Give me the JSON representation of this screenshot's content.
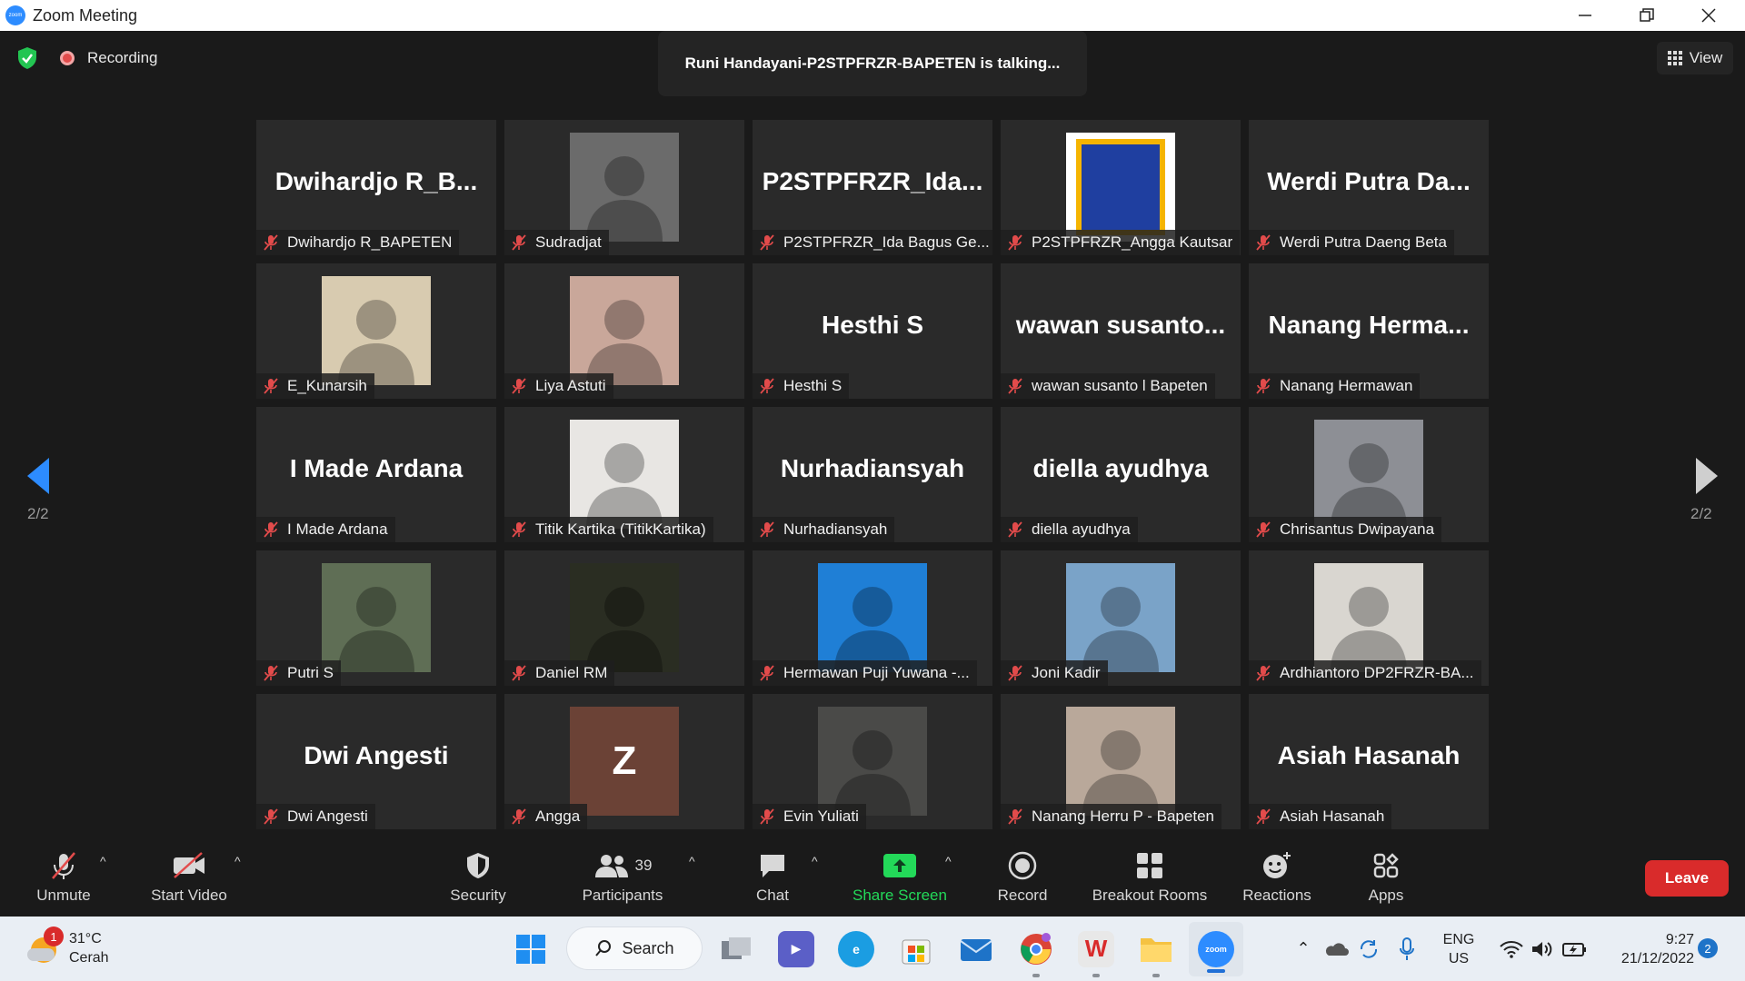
{
  "window": {
    "title": "Zoom Meeting"
  },
  "header": {
    "recording_label": "Recording",
    "talking_banner": "Runi Handayani-P2STPFRZR-BAPETEN is talking...",
    "view_label": "View"
  },
  "pagination": {
    "left_indicator": "2/2",
    "right_indicator": "2/2"
  },
  "tiles": [
    {
      "big_name": "Dwihardjo  R_B...",
      "label": "Dwihardjo R_BAPETEN",
      "has_avatar": false
    },
    {
      "big_name": "",
      "label": "Sudradjat",
      "has_avatar": true,
      "avatar": "photo-traffic-light",
      "bg": "#6b6b6b"
    },
    {
      "big_name": "P2STPFRZR_Ida...",
      "label": "P2STPFRZR_Ida Bagus Ge...",
      "has_avatar": false
    },
    {
      "big_name": "",
      "label": "P2STPFRZR_Angga Kautsar",
      "has_avatar": true,
      "avatar": "logo-ak",
      "bg": "#ffffff"
    },
    {
      "big_name": "Werdi  Putra  Da...",
      "label": "Werdi Putra Daeng Beta",
      "has_avatar": false
    },
    {
      "big_name": "",
      "label": "E_Kunarsih",
      "has_avatar": true,
      "avatar": "photo-film-portrait",
      "bg": "#d8cbb0"
    },
    {
      "big_name": "",
      "label": "Liya Astuti",
      "has_avatar": true,
      "avatar": "photo-hijab-smile",
      "bg": "#c9a79a"
    },
    {
      "big_name": "Hesthi S",
      "label": "Hesthi S",
      "has_avatar": false
    },
    {
      "big_name": "wawan  susanto...",
      "label": "wawan susanto l Bapeten",
      "has_avatar": false
    },
    {
      "big_name": "Nanang  Herma...",
      "label": "Nanang Hermawan",
      "has_avatar": false
    },
    {
      "big_name": "I Made Ardana",
      "label": "I Made Ardana",
      "has_avatar": false
    },
    {
      "big_name": "",
      "label": "Titik Kartika (TitikKartika)",
      "has_avatar": true,
      "avatar": "photo-hijab-mask",
      "bg": "#e8e6e3"
    },
    {
      "big_name": "Nurhadiansyah",
      "label": "Nurhadiansyah",
      "has_avatar": false
    },
    {
      "big_name": "diella ayudhya",
      "label": "diella ayudhya",
      "has_avatar": false
    },
    {
      "big_name": "",
      "label": "Chrisantus Dwipayana",
      "has_avatar": true,
      "avatar": "photo-mountain-couple",
      "bg": "#8d8f95"
    },
    {
      "big_name": "",
      "label": "Putri S",
      "has_avatar": true,
      "avatar": "photo-grass",
      "bg": "#5f6e55"
    },
    {
      "big_name": "",
      "label": "Daniel RM",
      "has_avatar": true,
      "avatar": "photo-man-night",
      "bg": "#2a2d22"
    },
    {
      "big_name": "",
      "label": "Hermawan Puji Yuwana -...",
      "has_avatar": true,
      "avatar": "photo-blue-portrait",
      "bg": "#1f7fd6"
    },
    {
      "big_name": "",
      "label": "Joni Kadir",
      "has_avatar": true,
      "avatar": "photo-man-selfie",
      "bg": "#7aa3c8"
    },
    {
      "big_name": "",
      "label": "Ardhiantoro DP2FRZR-BA...",
      "has_avatar": true,
      "avatar": "photo-woman-mask",
      "bg": "#d9d6d0"
    },
    {
      "big_name": "Dwi Angesti",
      "label": "Dwi Angesti",
      "has_avatar": false
    },
    {
      "big_name": "",
      "label": "Angga",
      "has_avatar": true,
      "avatar": "letter-avatar",
      "letter": "Z",
      "bg": "#6b4236"
    },
    {
      "big_name": "",
      "label": "Evin Yuliati",
      "has_avatar": true,
      "avatar": "photo-sunset-silhouette",
      "bg": "#4a4a48"
    },
    {
      "big_name": "",
      "label": "Nanang Herru P - Bapeten",
      "has_avatar": true,
      "avatar": "photo-couple-selfie",
      "bg": "#b9a89a"
    },
    {
      "big_name": "Asiah Hasanah",
      "label": "Asiah Hasanah",
      "has_avatar": false
    }
  ],
  "toolbar": {
    "unmute": "Unmute",
    "start_video": "Start Video",
    "security": "Security",
    "participants": "Participants",
    "participants_count": "39",
    "chat": "Chat",
    "share_screen": "Share Screen",
    "record": "Record",
    "breakout_rooms": "Breakout Rooms",
    "reactions": "Reactions",
    "apps": "Apps",
    "leave": "Leave"
  },
  "taskbar": {
    "weather_temp": "31°C",
    "weather_desc": "Cerah",
    "weather_badge": "1",
    "search_label": "Search",
    "lang_top": "ENG",
    "lang_bottom": "US",
    "time": "9:27",
    "date": "21/12/2022",
    "notification_count": "2"
  },
  "colors": {
    "accent_blue": "#2d8cff",
    "share_green": "#23d959",
    "leave_red": "#d92b2b",
    "muted_red": "#e24b4b"
  }
}
